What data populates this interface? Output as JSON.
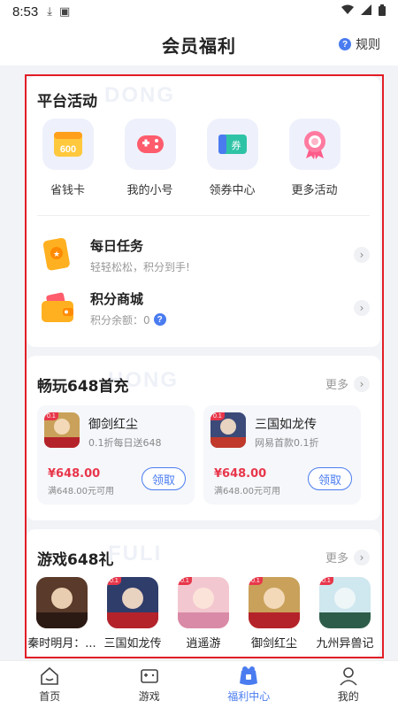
{
  "status_bar": {
    "time": "8:53"
  },
  "header": {
    "title": "会员福利",
    "rules_label": "规则"
  },
  "platform": {
    "title": "平台活动",
    "watermark": "DONG",
    "items": [
      {
        "label": "省钱卡",
        "icon": "savings-card-icon",
        "icon_text": "600"
      },
      {
        "label": "我的小号",
        "icon": "gamepad-icon"
      },
      {
        "label": "领券中心",
        "icon": "coupon-icon",
        "icon_text": "券"
      },
      {
        "label": "更多活动",
        "icon": "ribbon-badge-icon"
      }
    ],
    "daily": {
      "title": "每日任务",
      "subtitle": "轻轻松松，积分到手!"
    },
    "mall": {
      "title": "积分商城",
      "subtitle": "积分余额：0"
    }
  },
  "first_charge": {
    "title": "畅玩648首充",
    "watermark": "HONG",
    "more_label": "更多",
    "cards": [
      {
        "name": "御剑红尘",
        "desc": "0.1折每日送648",
        "price": "¥648.00",
        "condition": "满648.00元可用",
        "claim_label": "领取"
      },
      {
        "name": "三国如龙传",
        "desc": "网易首款0.1折",
        "price": "¥648.00",
        "condition": "满648.00元可用",
        "claim_label": "领取"
      }
    ]
  },
  "gift": {
    "title": "游戏648礼",
    "watermark": "FULI",
    "more_label": "更多",
    "games": [
      {
        "name": "秦时明月：..."
      },
      {
        "name": "三国如龙传"
      },
      {
        "name": "逍遥游"
      },
      {
        "name": "御剑红尘"
      },
      {
        "name": "九州异兽记"
      }
    ]
  },
  "tabs": [
    {
      "label": "首页",
      "icon": "home-icon"
    },
    {
      "label": "游戏",
      "icon": "games-icon"
    },
    {
      "label": "福利中心",
      "icon": "welfare-icon",
      "active": true
    },
    {
      "label": "我的",
      "icon": "profile-icon"
    }
  ],
  "colors": {
    "accent": "#4a7cf0",
    "price": "#e8364a",
    "highlight_border": "#e21d25"
  }
}
